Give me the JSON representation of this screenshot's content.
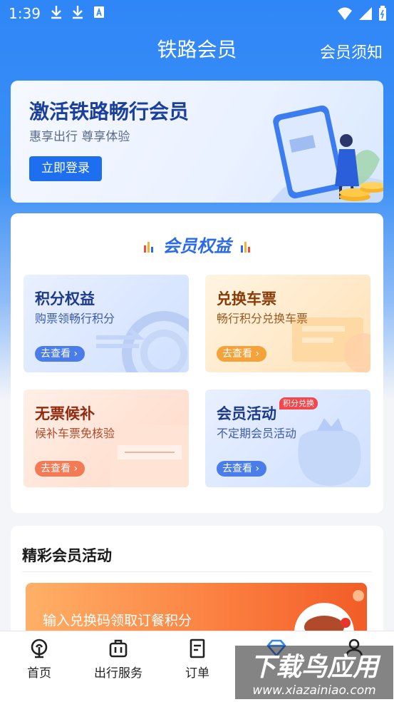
{
  "status_bar": {
    "time": "1:39"
  },
  "header": {
    "title": "铁路会员",
    "right_link": "会员须知"
  },
  "banner": {
    "title": "激活铁路畅行会员",
    "subtitle": "惠享出行 尊享体验",
    "login_button": "立即登录"
  },
  "benefits": {
    "title": "会员权益",
    "cards": [
      {
        "title": "积分权益",
        "subtitle": "购票领畅行积分",
        "button": "去查看"
      },
      {
        "title": "兑换车票",
        "subtitle": "畅行积分兑换车票",
        "button": "去查看"
      },
      {
        "title": "无票候补",
        "subtitle": "候补车票免核验",
        "button": "去查看"
      },
      {
        "title": "会员活动",
        "subtitle": "不定期会员活动",
        "button": "去查看",
        "badge": "积分兑换"
      }
    ]
  },
  "activities": {
    "title": "精彩会员活动",
    "promo_text": "输入兑换码领取订餐积分"
  },
  "tabbar": {
    "items": [
      {
        "label": "首页",
        "icon": "railway-logo-icon"
      },
      {
        "label": "出行服务",
        "icon": "luggage-icon"
      },
      {
        "label": "订单",
        "icon": "order-icon"
      },
      {
        "label": "",
        "icon": "member-diamond-icon"
      },
      {
        "label": "",
        "icon": "person-icon"
      }
    ]
  },
  "watermark": {
    "title": "下载鸟应用",
    "url": "www.xiazainiao.com"
  },
  "colors": {
    "primary": "#2f86f6",
    "accent": "#1e6ff0",
    "badge": "#f2484c"
  }
}
